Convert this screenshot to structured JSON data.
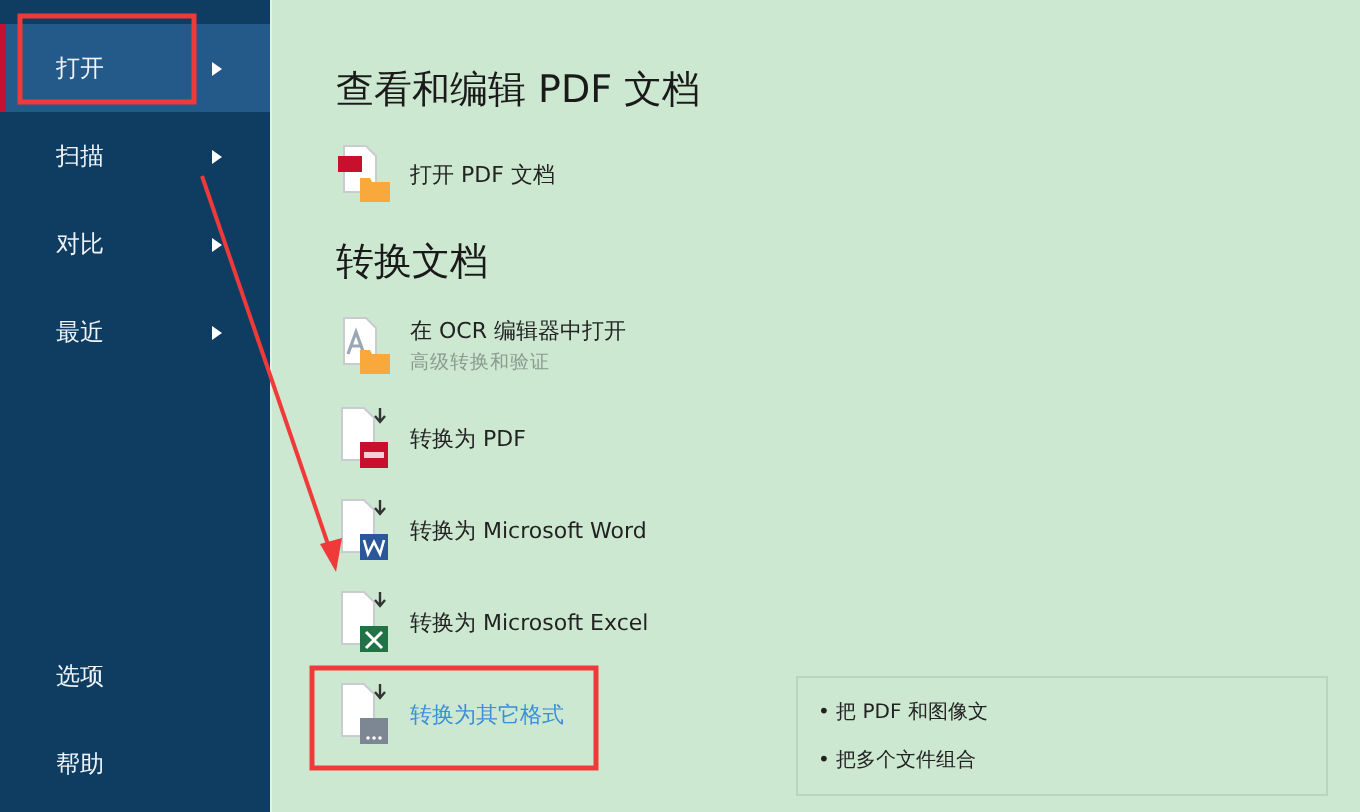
{
  "sidebar": {
    "items": [
      {
        "label": "打开",
        "selected": true,
        "has_submenu": true
      },
      {
        "label": "扫描",
        "selected": false,
        "has_submenu": true
      },
      {
        "label": "对比",
        "selected": false,
        "has_submenu": true
      },
      {
        "label": "最近",
        "selected": false,
        "has_submenu": true
      }
    ],
    "bottom_items": [
      {
        "label": "选项"
      },
      {
        "label": "帮助"
      }
    ]
  },
  "sections": [
    {
      "heading": "查看和编辑 PDF 文档",
      "items": [
        {
          "kind": "open-pdf",
          "label": "打开 PDF 文档",
          "selected": false
        }
      ]
    },
    {
      "heading": "转换文档",
      "items": [
        {
          "kind": "ocr",
          "label": "在 OCR 编辑器中打开",
          "subtitle": "高级转换和验证",
          "selected": false
        },
        {
          "kind": "to-pdf",
          "label": "转换为 PDF",
          "selected": false
        },
        {
          "kind": "to-word",
          "label": "转换为 Microsoft Word",
          "selected": false
        },
        {
          "kind": "to-excel",
          "label": "转换为 Microsoft Excel",
          "selected": false
        },
        {
          "kind": "to-other",
          "label": "转换为其它格式",
          "selected": true
        }
      ]
    }
  ],
  "tooltip": {
    "lines": [
      "• 把 PDF 和图像文",
      "• 把多个文件组合"
    ]
  }
}
